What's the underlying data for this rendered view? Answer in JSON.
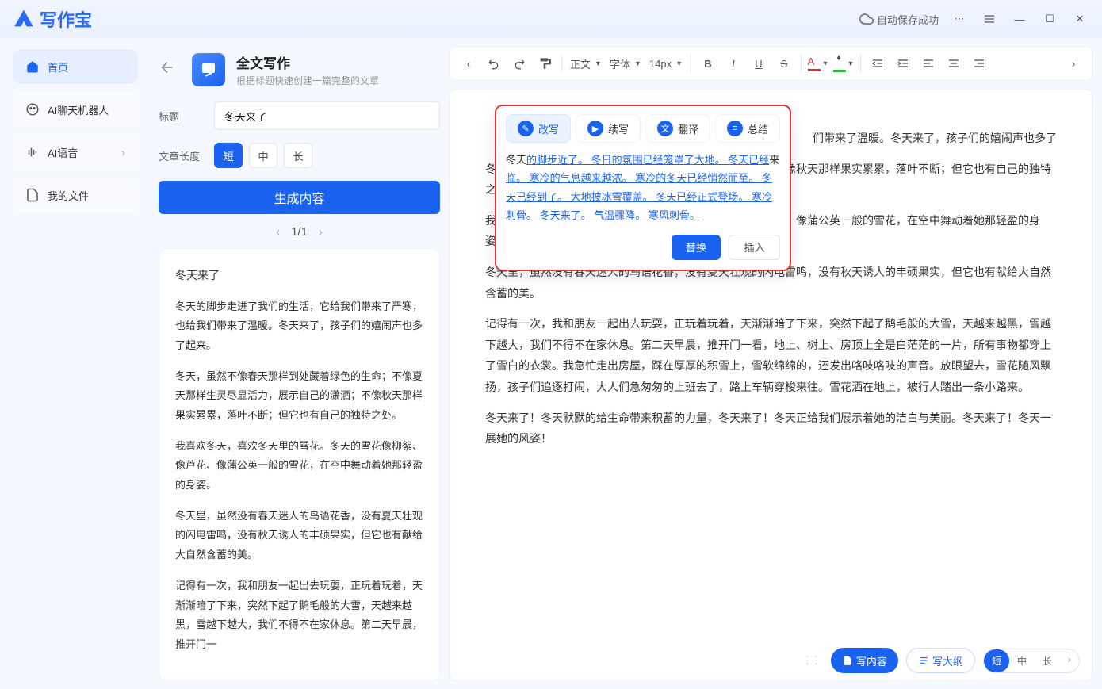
{
  "app": {
    "name": "写作宝",
    "autosave": "自动保存成功"
  },
  "sidebar": {
    "items": [
      {
        "label": "首页"
      },
      {
        "label": "AI聊天机器人"
      },
      {
        "label": "AI语音"
      },
      {
        "label": "我的文件"
      }
    ]
  },
  "panel": {
    "title": "全文写作",
    "subtitle": "根据标题快速创建一篇完整的文章",
    "title_label": "标题",
    "title_value": "冬天来了",
    "length_label": "文章长度",
    "len_short": "短",
    "len_mid": "中",
    "len_long": "长",
    "generate": "生成内容",
    "page": "1/1"
  },
  "preview": {
    "title": "冬天来了",
    "p1": "冬天的脚步走进了我们的生活，它给我们带来了严寒，也给我们带来了温暖。冬天来了，孩子们的嬉闹声也多了起来。",
    "p2": "冬天，虽然不像春天那样到处藏着绿色的生命；不像夏天那样生灵尽显活力，展示自己的潇洒；不像秋天那样果实累累，落叶不断；但它也有自己的独特之处。",
    "p3": "我喜欢冬天，喜欢冬天里的雪花。冬天的雪花像柳絮、像芦花、像蒲公英一般的雪花，在空中舞动着她那轻盈的身姿。",
    "p4": "冬天里，虽然没有春天迷人的鸟语花香，没有夏天壮观的闪电雷鸣，没有秋天诱人的丰硕果实，但它也有献给大自然含蓄的美。",
    "p5": "记得有一次，我和朋友一起出去玩耍，正玩着玩着，天渐渐暗了下来，突然下起了鹅毛般的大雪，天越来越黑，雪越下越大，我们不得不在家休息。第二天早晨，推开门一"
  },
  "toolbar": {
    "format": "正文",
    "font": "字体",
    "size": "14px"
  },
  "editor": {
    "p1a": "们带来了温暖。冬天来了，孩子们的嬉闹声也多了",
    "p1b": "冬天，虽然不像春天那样生灵尽显活力，展示自己的潇洒；不像秋天那样果实累累，落叶不断；但它也有自己的独特之处。",
    "p2": "我喜欢冬天，喜欢冬天里的雪花。冬天的雪花像柳絮、像芦花、像蒲公英一般的雪花，在空中舞动着她那轻盈的身姿。",
    "p3": "冬天里，虽然没有春天迷人的鸟语花香，没有夏天壮观的闪电雷鸣，没有秋天诱人的丰硕果实，但它也有献给大自然含蓄的美。",
    "p4": "记得有一次，我和朋友一起出去玩耍，正玩着玩着，天渐渐暗了下来，突然下起了鹅毛般的大雪，天越来越黑，雪越下越大，我们不得不在家休息。第二天早晨，推开门一看，地上、树上、房顶上全是白茫茫的一片，所有事物都穿上了雪白的衣裳。我急忙走出房屋，踩在厚厚的积雪上，雪软绵绵的，还发出咯吱咯吱的声音。放眼望去，雪花随风飘扬，孩子们追逐打闹，大人们急匆匆的上班去了，路上车辆穿梭来往。雪花洒在地上，被行人踏出一条小路来。",
    "p5": "冬天来了！冬天默默的给生命带来积蓄的力量，冬天来了！冬天正给我们展示着她的洁白与美丽。冬天来了！冬天一展她的风姿！"
  },
  "ai": {
    "tabs": {
      "rewrite": "改写",
      "continue": "续写",
      "translate": "翻译",
      "summary": "总结"
    },
    "text_plain": "冬天",
    "text_link": "的脚步近了。 冬日的氛围已经笼罩了大地。 冬天已经",
    "text_plain2": "来",
    "text_link2": "临。 寒冷的气息越来越浓。 寒冷的冬天已经悄然而至。 冬天已经到了。 大地披冰雪覆盖。 冬天已经正式登场。 寒冷刺骨。 冬天来了。 气温骤降。 寒风刺骨。",
    "replace": "替换",
    "insert": "插入"
  },
  "bottom": {
    "content": "写内容",
    "outline": "写大纲",
    "short": "短",
    "mid": "中",
    "long": "长"
  }
}
